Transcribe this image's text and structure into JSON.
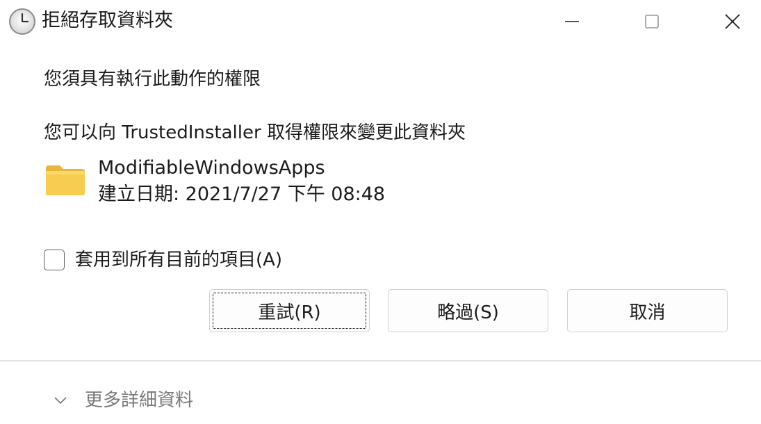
{
  "window": {
    "title": "拒絕存取資料夾",
    "icon": "clock-icon",
    "controls": [
      "minimize-icon",
      "maximize-icon",
      "close-icon"
    ]
  },
  "message": {
    "line1": "您須具有執行此動作的權限",
    "line2": "您可以向 TrustedInstaller 取得權限來變更此資料夾"
  },
  "folder": {
    "icon": "folder-icon",
    "name": "ModifiableWindowsApps",
    "created": "建立日期: 2021/7/27 下午 08:48"
  },
  "checkbox": {
    "label": "套用到所有目前的項目(A)",
    "checked": false
  },
  "buttons": {
    "retry": "重試(R)",
    "skip": "略過(S)",
    "cancel": "取消"
  },
  "details": {
    "label": "更多詳細資料",
    "icon": "chevron-down-icon"
  },
  "colors": {
    "folder": "#f7cd51",
    "folder_tab": "#e8b63a",
    "muted_text": "#7a7a7a"
  }
}
